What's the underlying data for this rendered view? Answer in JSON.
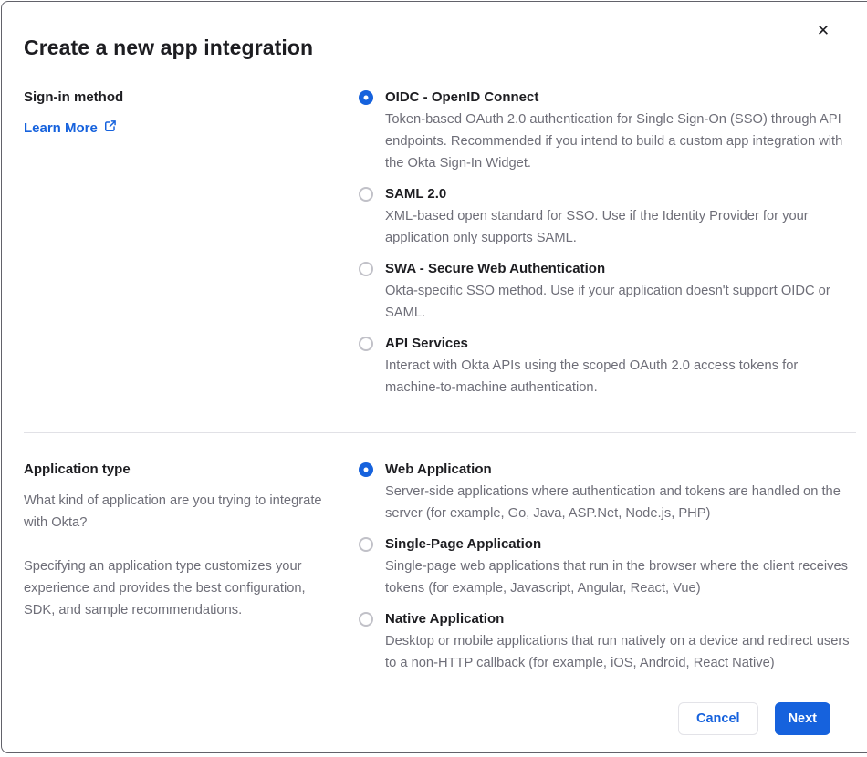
{
  "dialog": {
    "title": "Create a new app integration"
  },
  "icons": {
    "close": "✕"
  },
  "colors": {
    "accent_blue": "#1662dd",
    "heading_text": "#1d1d21",
    "body_text": "#6e6e78",
    "divider": "#e1e1e6"
  },
  "signin_section": {
    "label": "Sign-in method",
    "learn_more_label": "Learn More",
    "options": [
      {
        "label": "OIDC - OpenID Connect",
        "description": "Token-based OAuth 2.0 authentication for Single Sign-On (SSO) through API endpoints. Recommended if you intend to build a custom app integration with the Okta Sign-In Widget.",
        "selected": true
      },
      {
        "label": "SAML 2.0",
        "description": "XML-based open standard for SSO. Use if the Identity Provider for your application only supports SAML.",
        "selected": false
      },
      {
        "label": "SWA - Secure Web Authentication",
        "description": "Okta-specific SSO method. Use if your application doesn't support OIDC or SAML.",
        "selected": false
      },
      {
        "label": "API Services",
        "description": "Interact with Okta APIs using the scoped OAuth 2.0 access tokens for machine-to-machine authentication.",
        "selected": false
      }
    ]
  },
  "apptype_section": {
    "label": "Application type",
    "description_1": "What kind of application are you trying to integrate with Okta?",
    "description_2": "Specifying an application type customizes your experience and provides the best configuration, SDK, and sample recommendations.",
    "options": [
      {
        "label": "Web Application",
        "description": "Server-side applications where authentication and tokens are handled on the server (for example, Go, Java, ASP.Net, Node.js, PHP)",
        "selected": true
      },
      {
        "label": "Single-Page Application",
        "description": "Single-page web applications that run in the browser where the client receives tokens (for example, Javascript, Angular, React, Vue)",
        "selected": false
      },
      {
        "label": "Native Application",
        "description": "Desktop or mobile applications that run natively on a device and redirect users to a non-HTTP callback (for example, iOS, Android, React Native)",
        "selected": false
      }
    ]
  },
  "footer": {
    "cancel_label": "Cancel",
    "next_label": "Next"
  }
}
